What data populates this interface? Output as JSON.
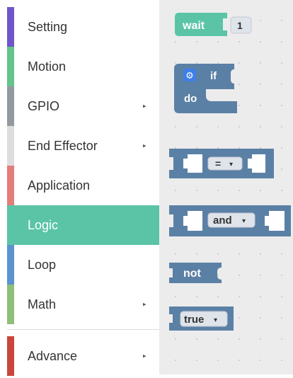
{
  "sidebar": {
    "categories": [
      {
        "label": "Setting",
        "color": "#6f55c9",
        "has_submenu": false,
        "selected": false
      },
      {
        "label": "Motion",
        "color": "#65c48a",
        "has_submenu": false,
        "selected": false
      },
      {
        "label": "GPIO",
        "color": "#939a9f",
        "has_submenu": true,
        "selected": false
      },
      {
        "label": "End Effector",
        "color": "#dddddd",
        "has_submenu": true,
        "selected": false
      },
      {
        "label": "Application",
        "color": "#e37d7b",
        "has_submenu": false,
        "selected": false
      },
      {
        "label": "Logic",
        "color": "#5bc4a7",
        "has_submenu": false,
        "selected": true
      },
      {
        "label": "Loop",
        "color": "#5b93d1",
        "has_submenu": false,
        "selected": false
      },
      {
        "label": "Math",
        "color": "#8fbf7a",
        "has_submenu": true,
        "selected": false
      },
      {
        "label": "Advance",
        "color": "#c9463c",
        "has_submenu": true,
        "selected": false
      }
    ],
    "submenu_arrow": "▸"
  },
  "blocks": {
    "wait": {
      "label": "wait",
      "value": "1",
      "color": "#5bc4a7"
    },
    "if_do": {
      "if_label": "if",
      "do_label": "do",
      "color": "#5b80a5",
      "gear_icon": "gear-icon"
    },
    "compare": {
      "operator": "=",
      "color": "#5b80a5"
    },
    "logic_op": {
      "operator": "and",
      "color": "#5b80a5"
    },
    "negate": {
      "label": "not",
      "color": "#5b80a5"
    },
    "boolean": {
      "value": "true",
      "color": "#5b80a5"
    },
    "dropdown_arrow": "▾"
  }
}
